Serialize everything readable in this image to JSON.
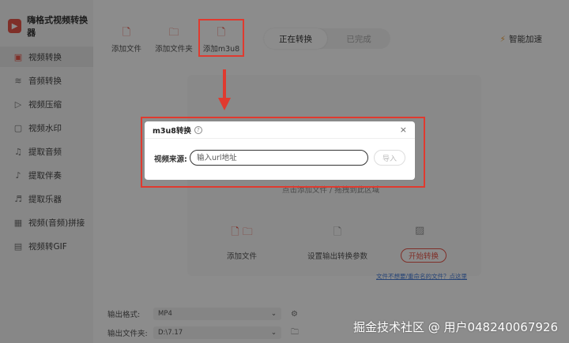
{
  "app": {
    "name": "嗨格式视频转换器"
  },
  "sidebar": {
    "items": [
      {
        "label": "视频转换"
      },
      {
        "label": "音频转换"
      },
      {
        "label": "视频压缩"
      },
      {
        "label": "视频水印"
      },
      {
        "label": "提取音频"
      },
      {
        "label": "提取伴奏"
      },
      {
        "label": "提取乐器"
      },
      {
        "label": "视频(音频)拼接"
      },
      {
        "label": "视频转GIF"
      }
    ]
  },
  "toolbar": {
    "add_file": "添加文件",
    "add_folder": "添加文件夹",
    "add_m3u8": "添加m3u8",
    "smart_accel": "智能加速"
  },
  "tabs": {
    "converting": "正在转换",
    "done": "已完成"
  },
  "dropzone": {
    "hint": "点击添加文件 / 拖拽到此区域",
    "step_add": "添加文件",
    "step_settings": "设置输出转换参数",
    "start": "开始转换",
    "link": "文件不想要/重命名的文件？点这里"
  },
  "output": {
    "format_label": "输出格式:",
    "format_value": "MP4",
    "folder_label": "输出文件夹:",
    "folder_value": "D:\\7.17"
  },
  "modal": {
    "title": "m3u8转换",
    "help": "?",
    "close": "×",
    "source_label": "视频来源:",
    "input_placeholder": "输入url地址",
    "import_button": "导入"
  },
  "watermark": "掘金技术社区 @ 用户048240067926",
  "colors": {
    "accent": "#e8564a",
    "annotation": "#e03a2f"
  }
}
